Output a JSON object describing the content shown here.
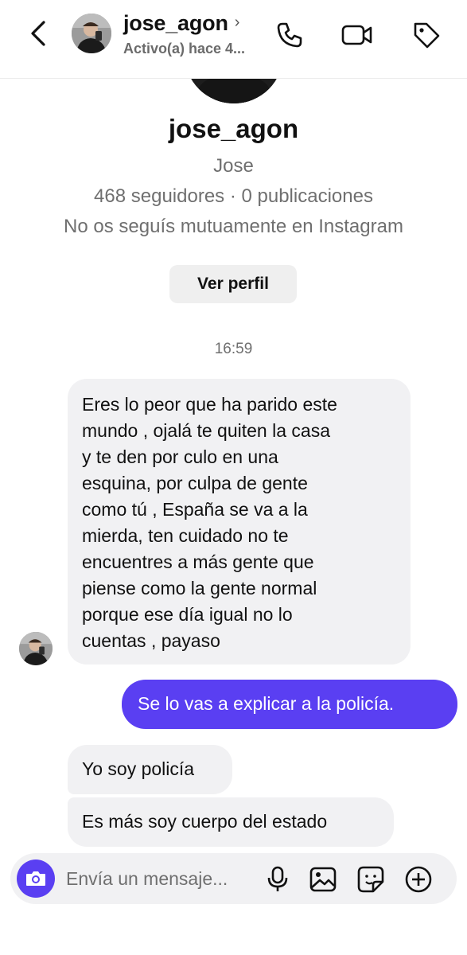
{
  "header": {
    "username": "jose_agon",
    "status": "Activo(a) hace 4...",
    "chevron": "›"
  },
  "profile": {
    "username": "jose_agon",
    "full_name": "Jose",
    "stats": "468 seguidores · 0 publicaciones",
    "mutual": "No os seguís mutuamente en Instagram",
    "view_profile_label": "Ver perfil"
  },
  "timestamp": "16:59",
  "messages": [
    {
      "from": "them",
      "lines": [
        "Eres lo peor que ha parido este",
        "mundo , ojalá te quiten la casa",
        "y te den por culo en una",
        "esquina, por culpa de gente",
        "como tú , España se va a la",
        "mierda, ten cuidado no te",
        "encuentres a más gente que",
        "piense como la gente normal",
        "porque ese día igual no lo",
        "cuentas , payaso"
      ]
    },
    {
      "from": "me",
      "text": "Se lo vas a explicar a la policía."
    },
    {
      "from": "them",
      "text": "Yo soy policía"
    },
    {
      "from": "them",
      "text": "Es más soy cuerpo del estado"
    }
  ],
  "composer": {
    "placeholder": "Envía un mensaje..."
  },
  "icons": {
    "back": "chevron-left-icon",
    "call": "phone-icon",
    "video": "video-camera-icon",
    "tag": "tag-icon",
    "camera": "camera-icon",
    "mic": "microphone-icon",
    "gallery": "image-icon",
    "sticker": "sticker-icon",
    "add": "plus-circle-icon"
  },
  "colors": {
    "accent": "#5a3ff2",
    "bubble_in": "#f1f1f3",
    "muted_text": "#6f6f6f"
  }
}
